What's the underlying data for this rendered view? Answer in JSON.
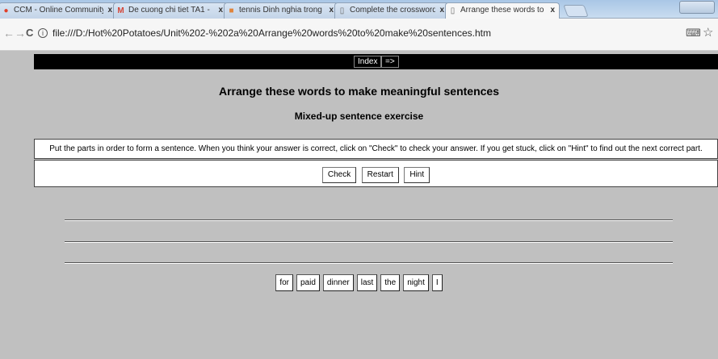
{
  "browser": {
    "tabs": [
      {
        "label": "CCM - Online Community",
        "icon": "ccm-icon",
        "icon_glyph": "●",
        "icon_color": "#e0402a",
        "active": false
      },
      {
        "label": "De cuong chi tiet TA1 - ",
        "icon": "gmail-icon",
        "icon_glyph": "M",
        "icon_color": "#d44638",
        "active": false
      },
      {
        "label": "tennis Dinh nghia trong",
        "icon": "site-icon",
        "icon_glyph": "■",
        "icon_color": "#e0843c",
        "active": false
      },
      {
        "label": "Complete the crossword",
        "icon": "page-icon",
        "icon_glyph": "▯",
        "icon_color": "#666666",
        "active": false
      },
      {
        "label": "Arrange these words to m",
        "icon": "page-icon",
        "icon_glyph": "▯",
        "icon_color": "#666666",
        "active": true
      }
    ],
    "close_glyph": "x",
    "url": "file:///D:/Hot%20Potatoes/Unit%202-%202a%20Arrange%20words%20to%20make%20sentences.htm",
    "info_glyph": "i",
    "back_glyph": "←",
    "forward_glyph": "→",
    "reload_glyph": "C",
    "translate_glyph": "⌨",
    "star_glyph": "☆"
  },
  "page": {
    "nav": {
      "index_label": "Index",
      "next_label": "=>"
    },
    "title": "Arrange these words to make meaningful sentences",
    "subtitle": "Mixed-up sentence exercise",
    "instructions": "Put the parts in order to form a sentence. When you think your answer is correct, click on \"Check\" to check your answer. If you get stuck, click on \"Hint\" to find out the next correct part.",
    "buttons": {
      "check": "Check",
      "restart": "Restart",
      "hint": "Hint"
    },
    "words": [
      "for",
      "paid",
      "dinner",
      "last",
      "the",
      "night",
      "I"
    ],
    "colors": {
      "page_bg": "#c0c0c0",
      "nav_bg": "#000000"
    }
  }
}
